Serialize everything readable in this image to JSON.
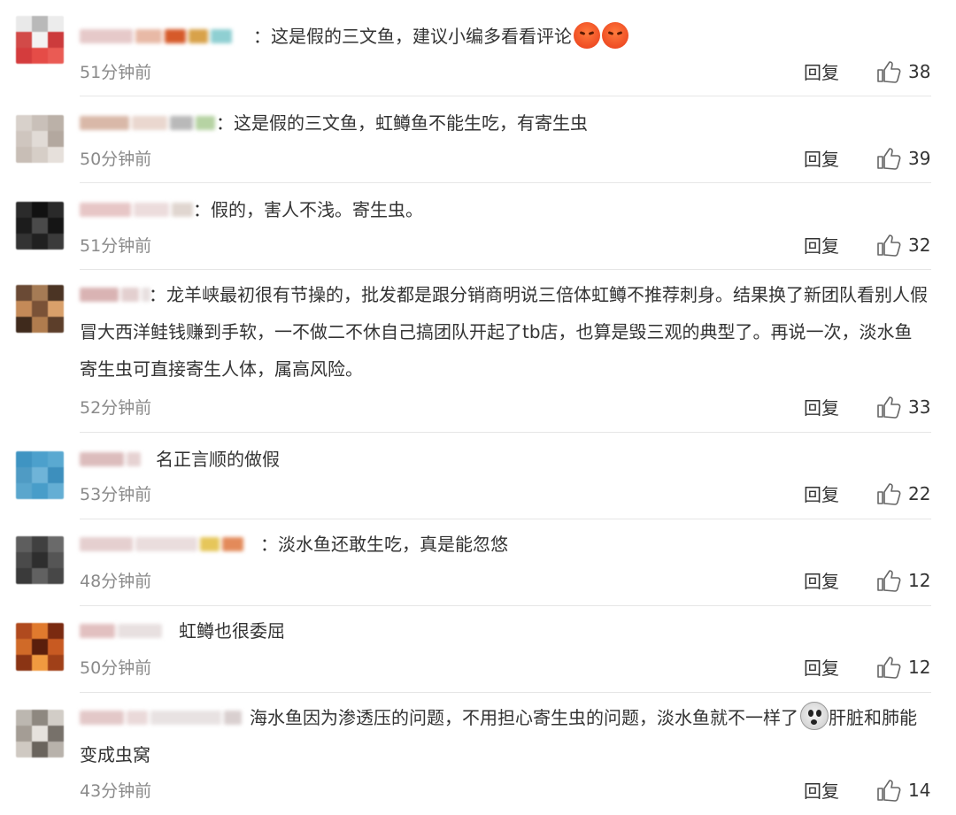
{
  "comments": [
    {
      "text": "：这是假的三文鱼，建议小编多看看评论",
      "emojis": [
        "angry",
        "angry"
      ],
      "time": "51分钟前",
      "reply": "回复",
      "likes": "38"
    },
    {
      "text": "：这是假的三文鱼，虹鳟鱼不能生吃，有寄生虫",
      "emojis": [],
      "time": "50分钟前",
      "reply": "回复",
      "likes": "39"
    },
    {
      "text": "：假的，害人不浅。寄生虫。",
      "emojis": [],
      "time": "51分钟前",
      "reply": "回复",
      "likes": "32"
    },
    {
      "text": "：龙羊峡最初很有节操的，批发都是跟分销商明说三倍体虹鳟不推荐刺身。结果换了新团队看别人假冒大西洋鲑钱赚到手软，一不做二不休自己搞团队开起了tb店，也算是毁三观的典型了。再说一次，淡水鱼寄生虫可直接寄生人体，属高风险。",
      "emojis": [],
      "time": "52分钟前",
      "reply": "回复",
      "likes": "33"
    },
    {
      "text": "名正言顺的做假",
      "emojis": [],
      "time": "53分钟前",
      "reply": "回复",
      "likes": "22"
    },
    {
      "text": "：淡水鱼还敢生吃，真是能忽悠",
      "emojis": [],
      "time": "48分钟前",
      "reply": "回复",
      "likes": "12"
    },
    {
      "text": "虹鳟也很委屈",
      "emojis": [],
      "time": "50分钟前",
      "reply": "回复",
      "likes": "12"
    },
    {
      "text_before": "海水鱼因为渗透压的问题，不用担心寄生虫的问题，淡水鱼就不一样了",
      "text_after": "肝脏和肺能变成虫窝",
      "emojis": [
        "shock"
      ],
      "time": "43分钟前",
      "reply": "回复",
      "likes": "14"
    }
  ],
  "colors": {
    "like_icon": "#666666",
    "time": "#8a8a8a",
    "text": "#333333",
    "divider": "#e6e6e6"
  },
  "icons": {
    "like": "thumbs-up-icon"
  }
}
